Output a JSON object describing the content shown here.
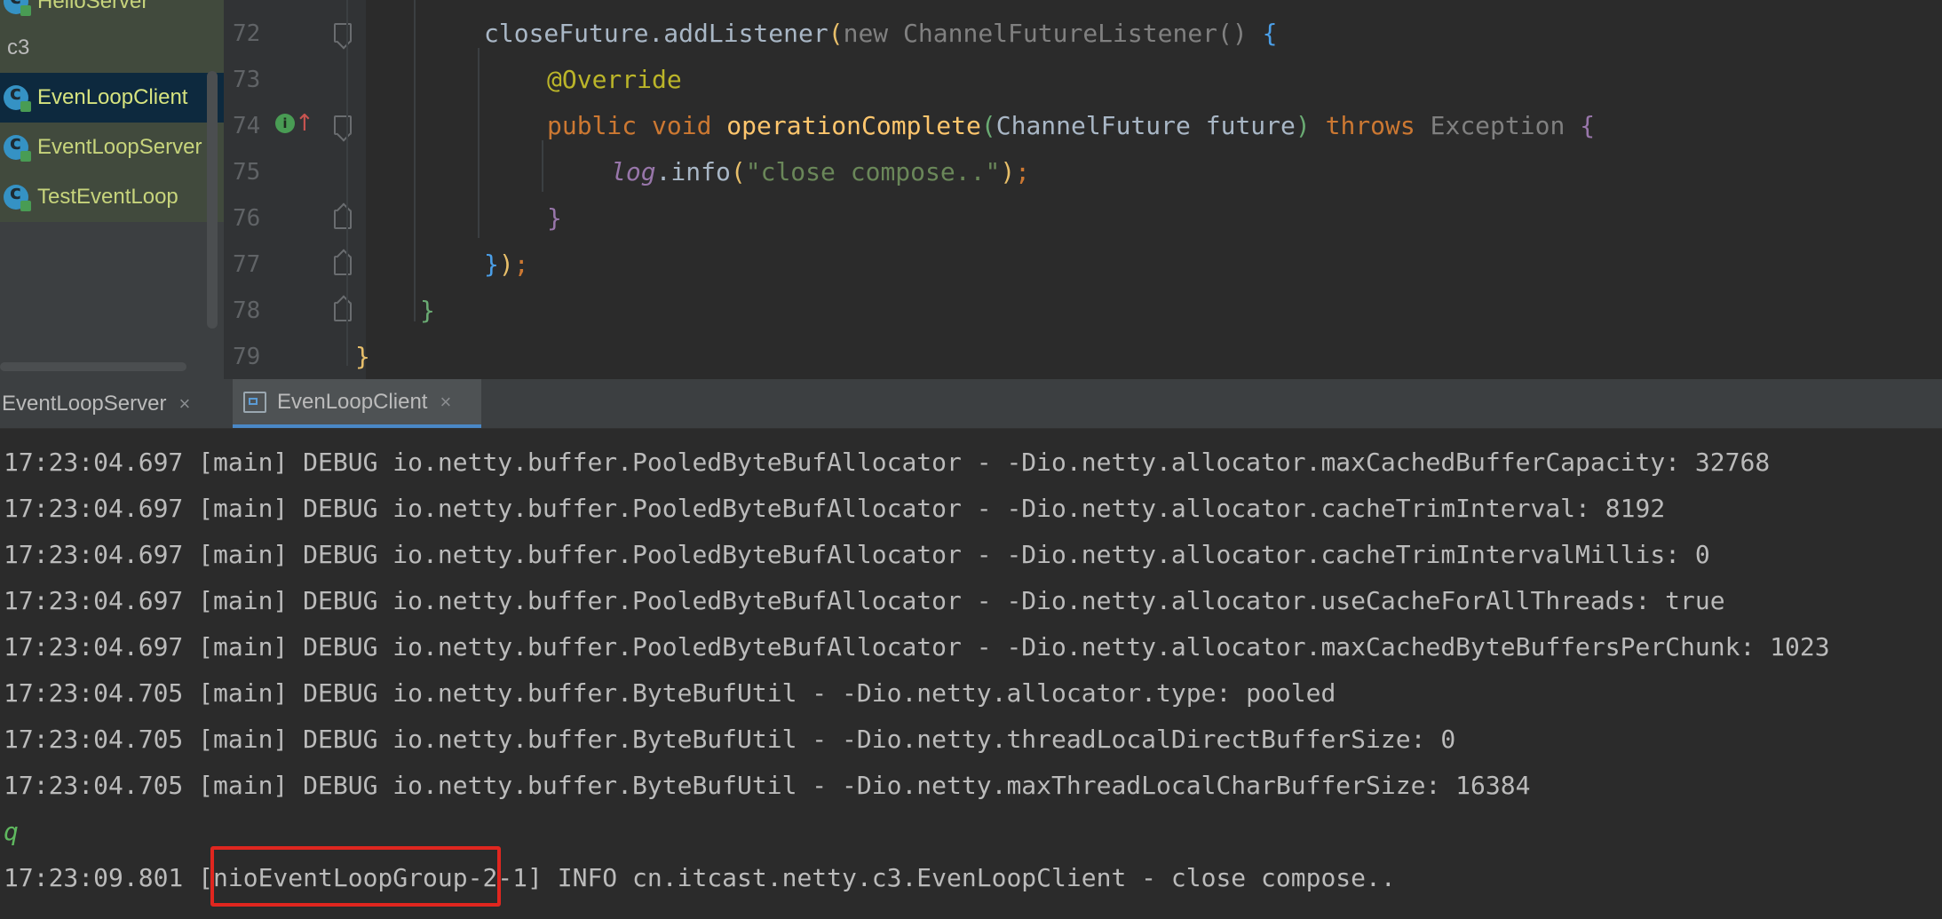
{
  "project_tree": {
    "items": [
      {
        "label": "HelloServer",
        "kind": "class"
      },
      {
        "label": "c3",
        "kind": "package"
      },
      {
        "label": "EvenLoopClient",
        "kind": "class",
        "selected": true
      },
      {
        "label": "EventLoopServer",
        "kind": "class"
      },
      {
        "label": "TestEventLoop",
        "kind": "class"
      }
    ]
  },
  "editor": {
    "line_numbers": [
      "72",
      "73",
      "74",
      "75",
      "76",
      "77",
      "78",
      "79"
    ],
    "lines": {
      "l72": {
        "a": "closeFuture.addListener",
        "p1": "(",
        "kw_new": "new ",
        "type": "ChannelFutureListener",
        "p2": "() ",
        "brace": "{"
      },
      "l73": {
        "anno": "@Override"
      },
      "l74": {
        "kw": "public void ",
        "fn": "operationComplete",
        "p1": "(",
        "param": "ChannelFuture future",
        "p2": ")",
        "kw_throws": " throws ",
        "exc": "Exception ",
        "brace": "{"
      },
      "l75": {
        "field": "log",
        "rest": ".info",
        "p1": "(",
        "str": "\"close compose..\"",
        "p2": ")",
        "semi": ";"
      },
      "l76": {
        "brace": "}"
      },
      "l77": {
        "brace": "}",
        "paren": ")",
        "semi": ";"
      },
      "l78": {
        "brace": "}"
      },
      "l79": {
        "brace": "}"
      }
    }
  },
  "run_window": {
    "tabs": [
      {
        "label": "EventLoopServer",
        "close": "×"
      },
      {
        "label": "EvenLoopClient",
        "close": "×",
        "active": true
      }
    ]
  },
  "console": {
    "lines": [
      "17:23:04.697 [main] DEBUG io.netty.buffer.PooledByteBufAllocator - -Dio.netty.allocator.maxCachedBufferCapacity: 32768",
      "17:23:04.697 [main] DEBUG io.netty.buffer.PooledByteBufAllocator - -Dio.netty.allocator.cacheTrimInterval: 8192",
      "17:23:04.697 [main] DEBUG io.netty.buffer.PooledByteBufAllocator - -Dio.netty.allocator.cacheTrimIntervalMillis: 0",
      "17:23:04.697 [main] DEBUG io.netty.buffer.PooledByteBufAllocator - -Dio.netty.allocator.useCacheForAllThreads: true",
      "17:23:04.697 [main] DEBUG io.netty.buffer.PooledByteBufAllocator - -Dio.netty.allocator.maxCachedByteBuffersPerChunk: 1023",
      "17:23:04.705 [main] DEBUG io.netty.buffer.ByteBufUtil - -Dio.netty.allocator.type: pooled",
      "17:23:04.705 [main] DEBUG io.netty.buffer.ByteBufUtil - -Dio.netty.threadLocalDirectBufferSize: 0",
      "17:23:04.705 [main] DEBUG io.netty.buffer.ByteBufUtil - -Dio.netty.maxThreadLocalCharBufferSize: 16384"
    ],
    "input_echo": "q",
    "info_line": "17:23:09.801 [nioEventLoopGroup-2-1] INFO cn.itcast.netty.c3.EvenLoopClient - close compose.."
  },
  "colors": {
    "highlight": "#e0261f",
    "keyword": "#cc7832",
    "string": "#6a8759",
    "function": "#ffc66d"
  }
}
